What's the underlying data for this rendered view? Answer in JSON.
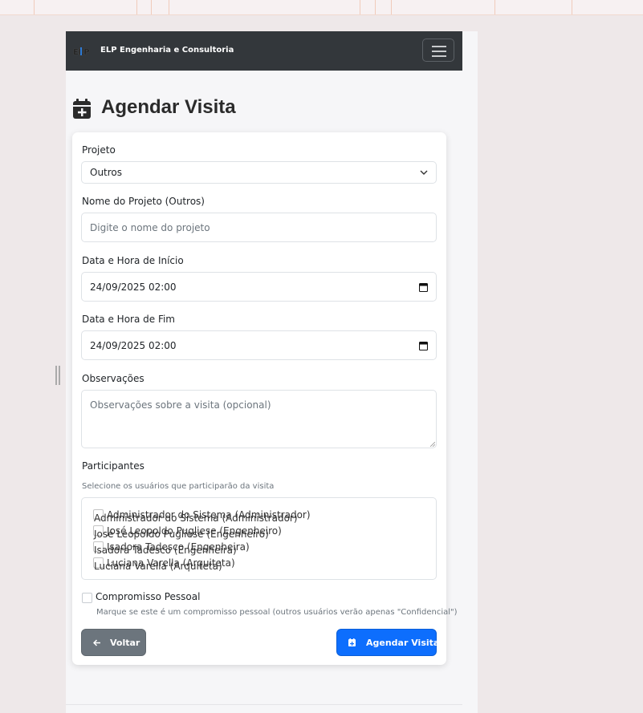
{
  "navbar": {
    "brand": "ELP Engenharia e Consultoria",
    "logo_text": "ELP"
  },
  "page": {
    "title": "Agendar Visita"
  },
  "form": {
    "project": {
      "label": "Projeto",
      "value": "Outros"
    },
    "project_name": {
      "label": "Nome do Projeto (Outros)",
      "placeholder": "Digite o nome do projeto"
    },
    "start": {
      "label": "Data e Hora de Início",
      "value": "24/09/2025 02:00"
    },
    "end": {
      "label": "Data e Hora de Fim",
      "value": "24/09/2025 02:00"
    },
    "notes": {
      "label": "Observações",
      "placeholder": "Observações sobre a visita (opcional)"
    },
    "participants": {
      "label": "Participantes",
      "hint": "Selecione os usuários que participarão da visita",
      "items": [
        "Administrador do Sistema (Administrador)",
        "José Leopoldo Pugliese (Engenheiro)",
        "Isadora Tadesco (Engenheira)",
        "Luciana Varella (Arquiteta)"
      ]
    },
    "personal": {
      "label": "Compromisso Pessoal",
      "hint": "Marque se este é um compromisso pessoal (outros usuários verão apenas \"Confidencial\")"
    },
    "back_label": "Voltar",
    "submit_label": "Agendar Visita"
  },
  "colors": {
    "navbar": "#33373b",
    "primary": "#0d6efd",
    "secondary": "#6c757d"
  }
}
